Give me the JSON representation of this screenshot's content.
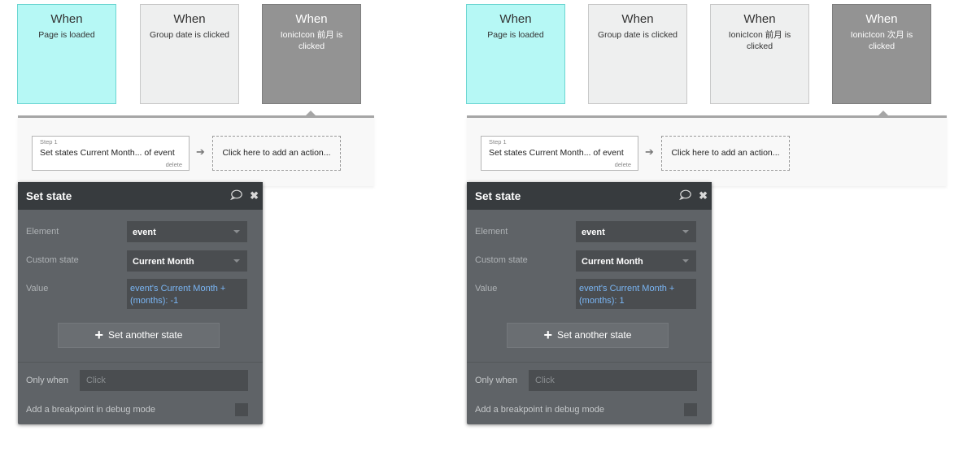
{
  "left": {
    "cards": [
      {
        "when": "When",
        "desc": "Page is loaded"
      },
      {
        "when": "When",
        "desc": "Group date is clicked"
      },
      {
        "when": "When",
        "desc": "IonicIcon 前月 is clicked"
      }
    ],
    "step": {
      "num": "Step 1",
      "text": "Set states Current Month... of event",
      "delete": "delete"
    },
    "add_action": "Click here to add an action...",
    "panel": {
      "title": "Set state",
      "element_label": "Element",
      "element_value": "event",
      "state_label": "Custom state",
      "state_value": "Current Month",
      "value_label": "Value",
      "value_value": "event's Current Month + (months): -1",
      "button": "Set another state",
      "only_when_label": "Only when",
      "only_when_placeholder": "Click",
      "breakpoint_label": "Add a breakpoint in debug mode"
    }
  },
  "right": {
    "cards": [
      {
        "when": "When",
        "desc": "Page is loaded"
      },
      {
        "when": "When",
        "desc": "Group date is clicked"
      },
      {
        "when": "When",
        "desc": "IonicIcon 前月 is clicked"
      },
      {
        "when": "When",
        "desc": "IonicIcon 次月 is clicked"
      }
    ],
    "step": {
      "num": "Step 1",
      "text": "Set states Current Month... of event",
      "delete": "delete"
    },
    "add_action": "Click here to add an action...",
    "panel": {
      "title": "Set state",
      "element_label": "Element",
      "element_value": "event",
      "state_label": "Custom state",
      "state_value": "Current Month",
      "value_label": "Value",
      "value_value": "event's Current Month + (months): 1",
      "button": "Set another state",
      "only_when_label": "Only when",
      "only_when_placeholder": "Click",
      "breakpoint_label": "Add a breakpoint in debug mode"
    }
  },
  "icons": {
    "comment": "comment-icon",
    "close": "close-icon",
    "arrow": "arrow-right-icon",
    "plus": "plus-icon",
    "caret": "caret-down-icon"
  },
  "colors": {
    "page_loaded_card": "#b6f8f5",
    "selected_card": "#939393",
    "panel_bg": "#5f6367",
    "panel_header": "#373b3e",
    "value_text": "#7ab6f5"
  }
}
